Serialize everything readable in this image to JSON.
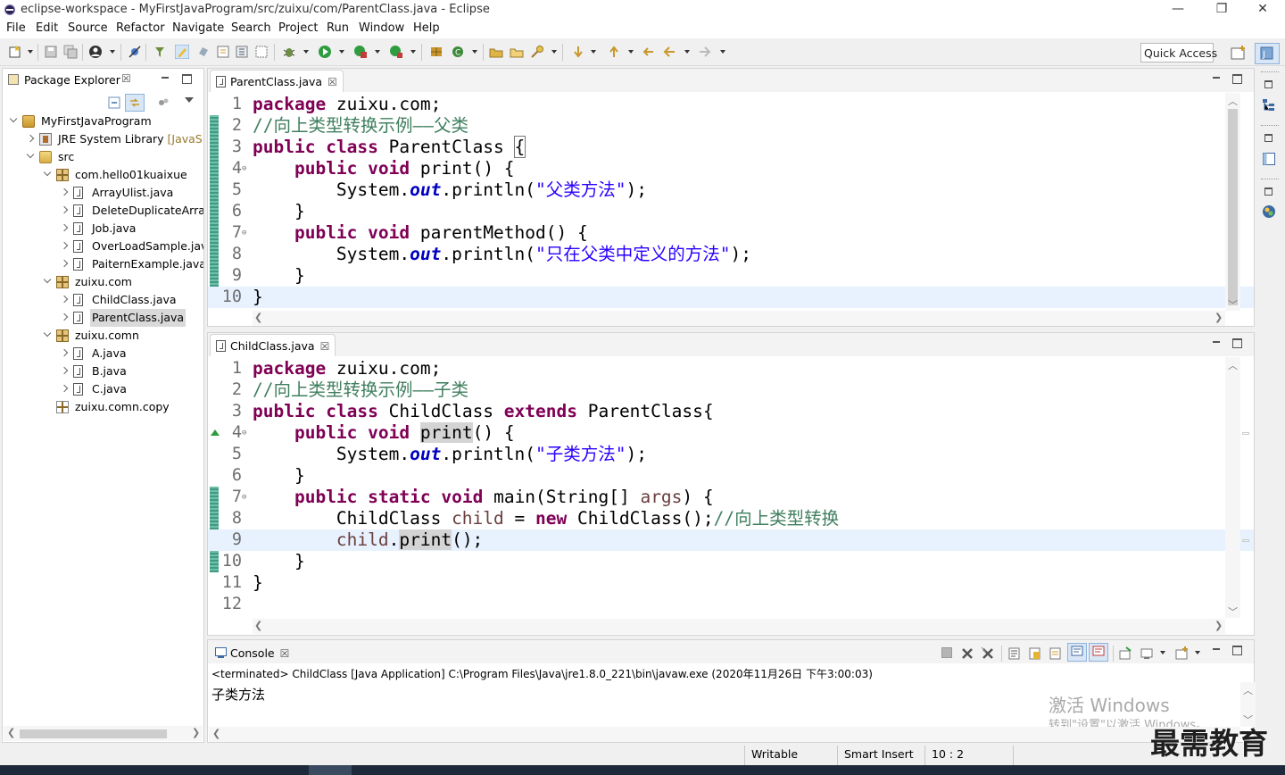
{
  "window": {
    "title": "eclipse-workspace - MyFirstJavaProgram/src/zuixu/com/ParentClass.java - Eclipse",
    "minimize_glyph": "—",
    "restore_glyph": "❐",
    "close_glyph": "✕"
  },
  "menu": [
    "File",
    "Edit",
    "Source",
    "Refactor",
    "Navigate",
    "Search",
    "Project",
    "Run",
    "Window",
    "Help"
  ],
  "toolbar": {
    "quick_access_label": "Quick Access",
    "icons": [
      "new-icon",
      "save-icon",
      "save-all-icon",
      "profile-icon",
      "skip-breakpoints-icon",
      "open-type-icon",
      "highlight-icon",
      "toggle-mark-icon",
      "debug-icon",
      "run-icon",
      "coverage-icon",
      "external-tools-icon",
      "new-package-icon",
      "new-class-icon",
      "open-task-icon",
      "search-icon",
      "next-annotation-icon",
      "prev-annotation-icon",
      "last-edit-icon",
      "back-icon",
      "forward-icon"
    ]
  },
  "package_explorer": {
    "tab_label": "Package Explorer",
    "close_glyph": "☒",
    "tree": [
      {
        "label": "MyFirstJavaProgram",
        "depth": 0,
        "icon": "project-icon",
        "twisty": "open"
      },
      {
        "label": "JRE System Library",
        "decoration": "[JavaSE-",
        "depth": 1,
        "icon": "library-icon",
        "twisty": "closed"
      },
      {
        "label": "src",
        "depth": 1,
        "icon": "source-folder-icon",
        "twisty": "open"
      },
      {
        "label": "com.hello01kuaixue",
        "depth": 2,
        "icon": "package-icon",
        "twisty": "open"
      },
      {
        "label": "ArrayUlist.java",
        "depth": 3,
        "icon": "java-file-icon",
        "twisty": "closed"
      },
      {
        "label": "DeleteDuplicateArray",
        "depth": 3,
        "icon": "java-file-icon",
        "twisty": "closed"
      },
      {
        "label": "Job.java",
        "depth": 3,
        "icon": "java-file-icon",
        "twisty": "closed"
      },
      {
        "label": "OverLoadSample.java",
        "depth": 3,
        "icon": "java-file-icon",
        "twisty": "closed"
      },
      {
        "label": "PaiternExample.java",
        "depth": 3,
        "icon": "java-file-icon",
        "twisty": "closed"
      },
      {
        "label": "zuixu.com",
        "depth": 2,
        "icon": "package-icon",
        "twisty": "open"
      },
      {
        "label": "ChildClass.java",
        "depth": 3,
        "icon": "java-file-icon",
        "twisty": "closed"
      },
      {
        "label": "ParentClass.java",
        "depth": 3,
        "icon": "java-file-icon",
        "twisty": "closed",
        "selected": true
      },
      {
        "label": "zuixu.comn",
        "depth": 2,
        "icon": "package-icon",
        "twisty": "open"
      },
      {
        "label": "A.java",
        "depth": 3,
        "icon": "java-file-icon",
        "twisty": "closed"
      },
      {
        "label": "B.java",
        "depth": 3,
        "icon": "java-file-icon",
        "twisty": "closed"
      },
      {
        "label": "C.java",
        "depth": 3,
        "icon": "java-file-icon",
        "twisty": "closed"
      },
      {
        "label": "zuixu.comn.copy",
        "depth": 2,
        "icon": "empty-package-icon",
        "twisty": "none"
      }
    ]
  },
  "editor_parent": {
    "tab_label": "ParentClass.java",
    "close_glyph": "☒",
    "current_line": 10,
    "lines": [
      {
        "n": "1",
        "html": "<span class=\"kw\">package</span> zuixu.com;"
      },
      {
        "n": "2",
        "html": "<span class=\"cm\">//向上类型转换示例——父类</span>"
      },
      {
        "n": "3",
        "html": "<span class=\"kw\">public</span> <span class=\"kw\">class</span> ParentClass <span class=\"brk\">{</span>"
      },
      {
        "n": "4",
        "fold": "⊖",
        "html": "    <span class=\"kw\">public</span> <span class=\"kw\">void</span> print() {"
      },
      {
        "n": "5",
        "html": "        System.<span class=\"fd\">out</span>.println(<span class=\"st\">\"父类方法\"</span>);"
      },
      {
        "n": "6",
        "html": "    }"
      },
      {
        "n": "7",
        "fold": "⊖",
        "html": "    <span class=\"kw\">public</span> <span class=\"kw\">void</span> parentMethod() {"
      },
      {
        "n": "8",
        "html": "        System.<span class=\"fd\">out</span>.println(<span class=\"st\">\"只在父类中定义的方法\"</span>);"
      },
      {
        "n": "9",
        "html": "    }"
      },
      {
        "n": "10",
        "html": "}"
      }
    ]
  },
  "editor_child": {
    "tab_label": "ChildClass.java",
    "close_glyph": "☒",
    "current_line": 9,
    "lines": [
      {
        "n": "1",
        "html": "<span class=\"kw\">package</span> zuixu.com;"
      },
      {
        "n": "2",
        "html": "<span class=\"cm\">//向上类型转换示例——子类</span>"
      },
      {
        "n": "3",
        "html": "<span class=\"kw\">public</span> <span class=\"kw\">class</span> ChildClass <span class=\"kw\">extends</span> ParentClass{"
      },
      {
        "n": "4",
        "fold": "⊖",
        "html": "    <span class=\"kw\">public</span> <span class=\"kw\">void</span> <span class=\"hl\">print</span>() {"
      },
      {
        "n": "5",
        "html": "        System.<span class=\"fd\">out</span>.println(<span class=\"st\">\"子类方法\"</span>);"
      },
      {
        "n": "6",
        "html": "    }"
      },
      {
        "n": "7",
        "fold": "⊖",
        "html": "    <span class=\"kw\">public</span> <span class=\"kw\">static</span> <span class=\"kw\">void</span> main(String[] <span class=\"lv\">args</span>) {"
      },
      {
        "n": "8",
        "html": "        ChildClass <span class=\"lv\">child</span> = <span class=\"kw\">new</span> ChildClass();<span class=\"cm\">//向上类型转换</span>"
      },
      {
        "n": "9",
        "html": "        <span class=\"lv\">child</span>.<span class=\"hl\">print</span>();"
      },
      {
        "n": "10",
        "html": "    }"
      },
      {
        "n": "11",
        "html": "}"
      },
      {
        "n": "12",
        "html": ""
      }
    ]
  },
  "console": {
    "tab_label": "Console",
    "close_glyph": "☒",
    "header": "<terminated> ChildClass [Java Application] C:\\Program Files\\Java\\jre1.8.0_221\\bin\\javaw.exe (2020年11月26日 下午3:00:03)",
    "output": "子类方法",
    "watermark_line1": "激活 Windows",
    "watermark_line2": "转到\"设置\"以激活 Windows。"
  },
  "statusbar": {
    "writable": "Writable",
    "insert_mode": "Smart Insert",
    "position": "10 : 2"
  },
  "brand_watermark": "最需教育",
  "colors": {
    "keyword": "#7f0055",
    "comment": "#3f7f5f",
    "string": "#2a00ff",
    "field": "#0000c0",
    "current_line": "#e8f2fe",
    "selection": "#cce4f7"
  }
}
